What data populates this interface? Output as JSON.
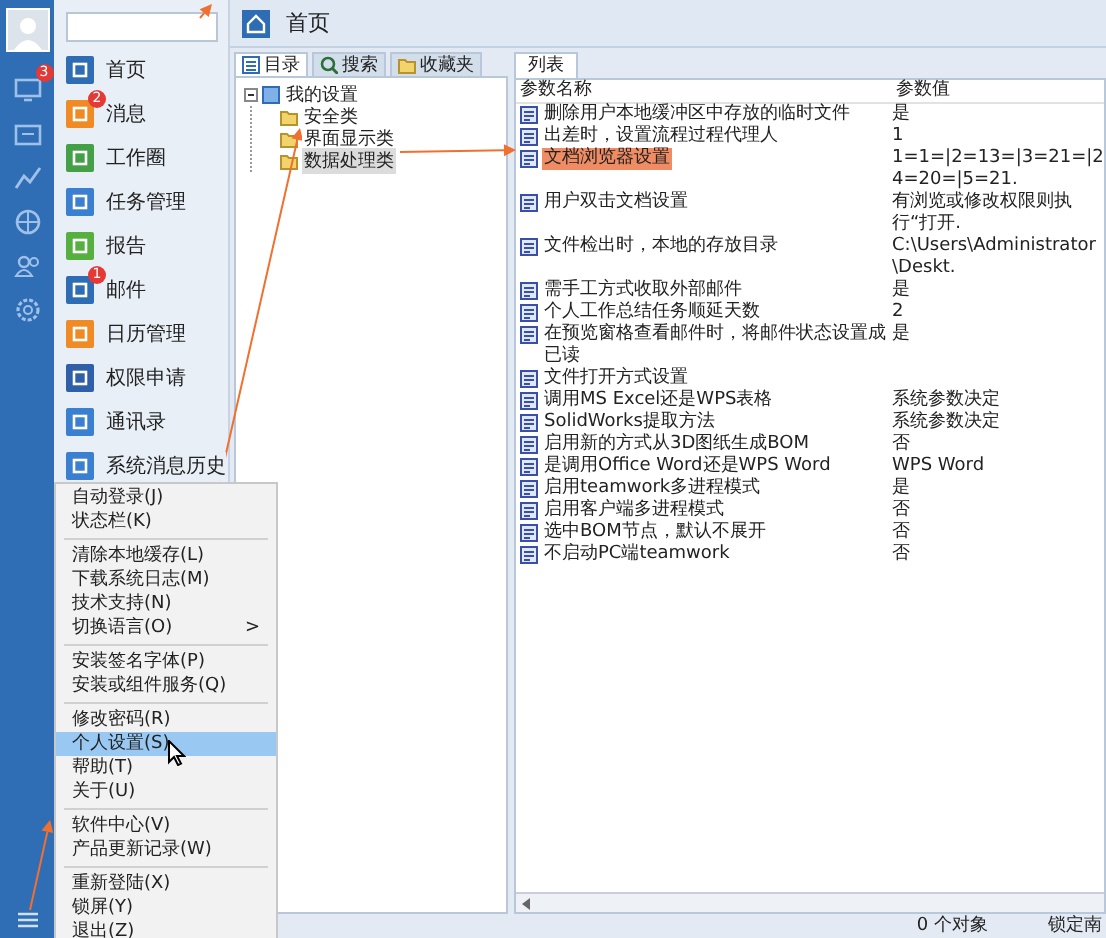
{
  "rail": {
    "badge": "3"
  },
  "nav": {
    "items": [
      {
        "label": "首页",
        "color": "#2e6db4"
      },
      {
        "label": "消息",
        "color": "#f08a24",
        "badge": "2"
      },
      {
        "label": "工作圈",
        "color": "#43a047"
      },
      {
        "label": "任务管理",
        "color": "#3b7fd0"
      },
      {
        "label": "报告",
        "color": "#55b040"
      },
      {
        "label": "邮件",
        "color": "#2e6db4",
        "badge": "1"
      },
      {
        "label": "日历管理",
        "color": "#f08a24"
      },
      {
        "label": "权限申请",
        "color": "#2e5fa8"
      },
      {
        "label": "通讯录",
        "color": "#3b7fd0"
      },
      {
        "label": "系统消息历史",
        "color": "#3b7fd0"
      }
    ]
  },
  "menu": {
    "items": [
      {
        "kind": "item",
        "label": "自动登录(J)",
        "selected": false
      },
      {
        "kind": "item",
        "label": "状态栏(K)",
        "selected": false
      },
      {
        "kind": "separator"
      },
      {
        "kind": "item",
        "label": "清除本地缓存(L)",
        "selected": false
      },
      {
        "kind": "item",
        "label": "下载系统日志(M)",
        "selected": false
      },
      {
        "kind": "item",
        "label": "技术支持(N)",
        "selected": false
      },
      {
        "kind": "item",
        "label": "切换语言(O)",
        "selected": false,
        "arrow": ">"
      },
      {
        "kind": "separator"
      },
      {
        "kind": "item",
        "label": "安装签名字体(P)",
        "selected": false
      },
      {
        "kind": "item",
        "label": "安装或组件服务(Q)",
        "selected": false
      },
      {
        "kind": "separator"
      },
      {
        "kind": "item",
        "label": "修改密码(R)",
        "selected": false
      },
      {
        "kind": "item",
        "label": "个人设置(S)",
        "selected": true
      },
      {
        "kind": "item",
        "label": "帮助(T)",
        "selected": false
      },
      {
        "kind": "item",
        "label": "关于(U)",
        "selected": false
      },
      {
        "kind": "separator"
      },
      {
        "kind": "item",
        "label": "软件中心(V)",
        "selected": false
      },
      {
        "kind": "item",
        "label": "产品更新记录(W)",
        "selected": false
      },
      {
        "kind": "separator"
      },
      {
        "kind": "item",
        "label": "重新登陆(X)",
        "selected": false
      },
      {
        "kind": "item",
        "label": "锁屏(Y)",
        "selected": false
      },
      {
        "kind": "item",
        "label": "退出(Z)",
        "selected": false
      }
    ]
  },
  "header": {
    "title": "首页"
  },
  "left_pane": {
    "tabs": [
      {
        "label": "目录",
        "selected": true
      },
      {
        "label": "搜索",
        "selected": false
      },
      {
        "label": "收藏夹",
        "selected": false
      }
    ],
    "tree": {
      "label": "我的设置",
      "expanded": true,
      "children": [
        {
          "label": "安全类",
          "selected": false
        },
        {
          "label": "界面显示类",
          "selected": false
        },
        {
          "label": "数据处理类",
          "selected": true
        }
      ]
    }
  },
  "right_pane": {
    "tab": "列表",
    "table": {
      "columns": [
        "参数名称",
        "参数值"
      ],
      "rows": [
        {
          "name": "删除用户本地缓冲区中存放的临时文件",
          "value": "是",
          "selected": false
        },
        {
          "name": "出差时，设置流程过程代理人",
          "value": "1",
          "selected": false
        },
        {
          "name": "文档浏览器设置",
          "value": "1=1=|2=13=|3=21=|24=20=|5=21.",
          "selected": true
        },
        {
          "name": "用户双击文档设置",
          "value": "有浏览或修改权限则执行“打开.",
          "selected": false
        },
        {
          "name": "文件检出时，本地的存放目录",
          "value": "C:\\Users\\Administrator\\Deskt.",
          "selected": false
        },
        {
          "name": "需手工方式收取外部邮件",
          "value": "是",
          "selected": false
        },
        {
          "name": "个人工作总结任务顺延天数",
          "value": "2",
          "selected": false
        },
        {
          "name": "在预览窗格查看邮件时，将邮件状态设置成已读",
          "value": "是",
          "selected": false
        },
        {
          "name": "文件打开方式设置",
          "selected": false
        },
        {
          "name": "调用MS Excel还是WPS表格",
          "value": "系统参数决定",
          "selected": false
        },
        {
          "name": "SolidWorks提取方法",
          "value": "系统参数决定",
          "selected": false
        },
        {
          "name": "启用新的方式从3D图纸生成BOM",
          "value": "否",
          "selected": false
        },
        {
          "name": "是调用Office Word还是WPS Word",
          "value": "WPS Word",
          "selected": false
        },
        {
          "name": "启用teamwork多进程模式",
          "value": "是",
          "selected": false
        },
        {
          "name": "启用客户端多进程模式",
          "value": "否",
          "selected": false
        },
        {
          "name": "选中BOM节点，默认不展开",
          "value": "否",
          "selected": false
        },
        {
          "name": "不启动PC端teamwork",
          "value": "否",
          "selected": false
        }
      ]
    }
  },
  "status_bar": {
    "count": "0 个对象",
    "lock": "锁定南"
  }
}
